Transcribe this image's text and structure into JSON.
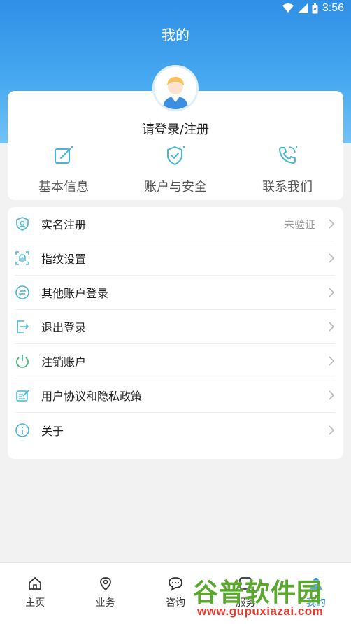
{
  "status_bar": {
    "time": "3:56"
  },
  "header": {
    "title": "我的"
  },
  "profile": {
    "login_text": "请登录/注册"
  },
  "quick_actions": [
    {
      "label": "基本信息",
      "icon": "edit-icon"
    },
    {
      "label": "账户与安全",
      "icon": "shield-check-icon"
    },
    {
      "label": "联系我们",
      "icon": "phone-icon"
    }
  ],
  "menu": {
    "items": [
      {
        "label": "实名注册",
        "value": "未验证",
        "icon": "id-shield-icon"
      },
      {
        "label": "指纹设置",
        "value": "",
        "icon": "fingerprint-icon"
      },
      {
        "label": "其他账户登录",
        "value": "",
        "icon": "switch-account-icon"
      },
      {
        "label": "退出登录",
        "value": "",
        "icon": "logout-icon"
      },
      {
        "label": "注销账户",
        "value": "",
        "icon": "power-icon"
      },
      {
        "label": "用户协议和隐私政策",
        "value": "",
        "icon": "agreement-icon"
      },
      {
        "label": "关于",
        "value": "",
        "icon": "info-icon"
      }
    ]
  },
  "tabbar": {
    "tabs": [
      {
        "label": "主页",
        "icon": "home-icon"
      },
      {
        "label": "业务",
        "icon": "location-icon"
      },
      {
        "label": "咨询",
        "icon": "chat-icon"
      },
      {
        "label": "服务",
        "icon": "service-icon"
      },
      {
        "label": "我的",
        "icon": "user-icon"
      }
    ]
  },
  "watermark": {
    "text": "谷普软件园",
    "url": "www.gupuxiazai.com"
  },
  "colors": {
    "accent": "#2f8fe6",
    "icon_teal": "#45b6d8",
    "power_green": "#3cb371"
  }
}
